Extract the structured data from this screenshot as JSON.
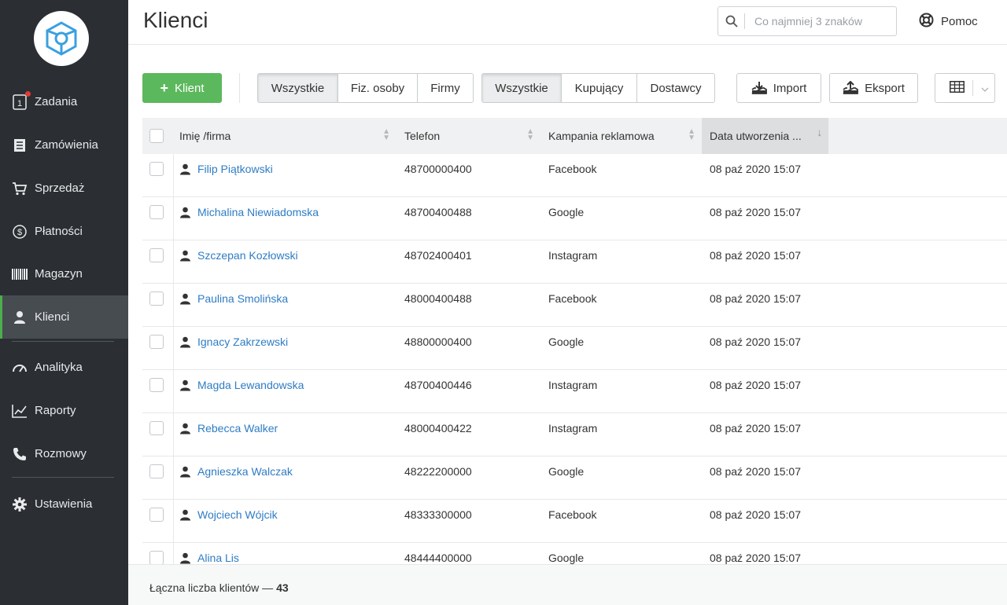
{
  "sidebar": {
    "items": [
      {
        "label": "Zadania",
        "icon": "tasks-icon"
      },
      {
        "label": "Zamówienia",
        "icon": "orders-icon"
      },
      {
        "label": "Sprzedaż",
        "icon": "cart-icon"
      },
      {
        "label": "Płatności",
        "icon": "dollar-icon"
      },
      {
        "label": "Magazyn",
        "icon": "barcode-icon"
      },
      {
        "label": "Klienci",
        "icon": "user-icon",
        "active": true
      },
      {
        "label": "Analityka",
        "icon": "gauge-icon"
      },
      {
        "label": "Raporty",
        "icon": "chart-icon"
      },
      {
        "label": "Rozmowy",
        "icon": "phone-icon"
      },
      {
        "label": "Ustawienia",
        "icon": "gear-icon"
      }
    ],
    "tasks_badge_digit": "1"
  },
  "header": {
    "title": "Klienci",
    "search_placeholder": "Co najmniej 3 znaków",
    "help_label": "Pomoc"
  },
  "toolbar": {
    "add_label": "Klient",
    "type_filters": [
      "Wszystkie",
      "Fiz. osoby",
      "Firmy"
    ],
    "role_filters": [
      "Wszystkie",
      "Kupujący",
      "Dostawcy"
    ],
    "import_label": "Import",
    "export_label": "Eksport"
  },
  "table": {
    "columns": [
      "Imię /firma",
      "Telefon",
      "Kampania reklamowa",
      "Data utworzenia ..."
    ],
    "rows": [
      {
        "name": "Filip Piątkowski",
        "phone": "48700000400",
        "campaign": "Facebook",
        "date": "08 paź 2020 15:07"
      },
      {
        "name": "Michalina Niewiadomska",
        "phone": "48700400488",
        "campaign": "Google",
        "date": "08 paź 2020 15:07"
      },
      {
        "name": "Szczepan Kozłowski",
        "phone": "48702400401",
        "campaign": "Instagram",
        "date": "08 paź 2020 15:07"
      },
      {
        "name": "Paulina Smolińska",
        "phone": "48000400488",
        "campaign": "Facebook",
        "date": "08 paź 2020 15:07"
      },
      {
        "name": "Ignacy Zakrzewski",
        "phone": "48800000400",
        "campaign": "Google",
        "date": "08 paź 2020 15:07"
      },
      {
        "name": "Magda Lewandowska",
        "phone": "48700400446",
        "campaign": "Instagram",
        "date": "08 paź 2020 15:07"
      },
      {
        "name": "Rebecca Walker",
        "phone": "48000400422",
        "campaign": "Instagram",
        "date": "08 paź 2020 15:07"
      },
      {
        "name": "Agnieszka Walczak",
        "phone": "48222200000",
        "campaign": "Google",
        "date": "08 paź 2020 15:07"
      },
      {
        "name": "Wojciech Wójcik",
        "phone": "48333300000",
        "campaign": "Facebook",
        "date": "08 paź 2020 15:07"
      },
      {
        "name": "Alina Lis",
        "phone": "48444400000",
        "campaign": "Google",
        "date": "08 paź 2020 15:07"
      }
    ]
  },
  "footer": {
    "total_label": "Łączna liczba klientów — ",
    "total_count": "43"
  },
  "colors": {
    "sidebar_bg": "#2b2f33",
    "accent_green": "#5cb85c",
    "link_blue": "#2e7cc4",
    "logo_blue": "#3aa0e0"
  }
}
